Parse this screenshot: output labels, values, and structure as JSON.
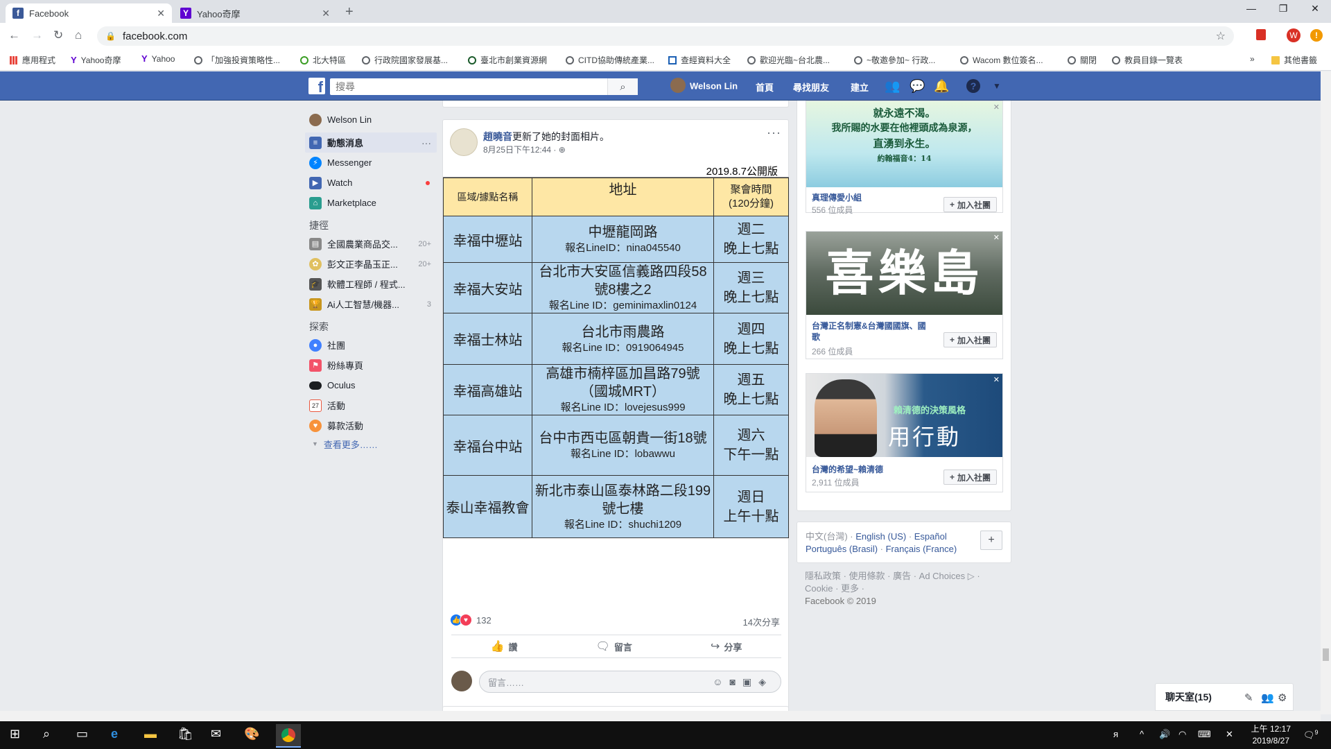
{
  "browser": {
    "tabs": [
      {
        "title": "Facebook",
        "icon": "facebook-icon",
        "active": true
      },
      {
        "title": "Yahoo奇摩",
        "icon": "yahoo-icon",
        "active": false
      }
    ],
    "url": "facebook.com",
    "bookmarks": [
      "應用程式",
      "Yahoo奇摩",
      "Yahoo",
      "「加強投資策略性...",
      "北大特區",
      "行政院國家發展基...",
      "臺北市創業資源網",
      "CITD協助傳統產業...",
      "查經資料大全",
      "歡迎光臨~台北農...",
      "~敬邀參加~ 行政...",
      "Wacom 數位簽名...",
      "關閉",
      "教員目錄一覽表",
      "»",
      "其他書籤"
    ]
  },
  "fb": {
    "search_placeholder": "搜尋",
    "user_name": "Welson Lin",
    "nav_home": "首頁",
    "nav_find_friends": "尋找朋友",
    "nav_create": "建立"
  },
  "leftnav": {
    "profile": "Welson Lin",
    "main": [
      {
        "label": "動態消息",
        "icon": "newsfeed-icon",
        "color": "#4267b2"
      },
      {
        "label": "Messenger",
        "icon": "messenger-icon",
        "color": "#0084ff"
      },
      {
        "label": "Watch",
        "icon": "watch-icon",
        "color": "#4267b2"
      },
      {
        "label": "Marketplace",
        "icon": "marketplace-icon",
        "color": "#2a9d8f"
      }
    ],
    "shortcuts_title": "捷徑",
    "shortcuts": [
      {
        "label": "全國農業商品交...",
        "count": "20+"
      },
      {
        "label": "彭文正李晶玉正...",
        "count": "20+"
      },
      {
        "label": "軟體工程師 / 程式...",
        "count": ""
      },
      {
        "label": "Ai人工智慧/機器...",
        "count": "3"
      }
    ],
    "explore_title": "探索",
    "explore": [
      {
        "label": "社團",
        "icon": "groups-icon",
        "color": "#4080ff"
      },
      {
        "label": "粉絲專頁",
        "icon": "pages-icon",
        "color": "#f35369"
      },
      {
        "label": "Oculus",
        "icon": "oculus-icon",
        "color": "#1c1e21"
      },
      {
        "label": "活動",
        "icon": "events-icon",
        "color": "#e9573f"
      },
      {
        "label": "募款活動",
        "icon": "fundraisers-icon",
        "color": "#f7923b"
      }
    ],
    "see_more": "查看更多……"
  },
  "post": {
    "author": "趙曉音",
    "action": "更新了她的封面相片。",
    "time": "8月25日下午12:44 · ",
    "more": "···",
    "schedule": {
      "version": "2019.8.7公開版",
      "headers": [
        "區域/據點名稱",
        "地址",
        "聚會時間",
        "(120分鐘)"
      ],
      "rows": [
        {
          "name": "幸福中壢站",
          "addr": "中壢龍岡路",
          "line": "報名LineID：nina045540",
          "day": "週二",
          "time": "晚上七點"
        },
        {
          "name": "幸福大安站",
          "addr": "台北市大安區信義路四段58號8樓之2",
          "line": "報名Line ID：geminimaxlin0124",
          "day": "週三",
          "time": "晚上七點"
        },
        {
          "name": "幸福士林站",
          "addr": "台北市雨農路",
          "line": "報名Line ID：0919064945",
          "day": "週四",
          "time": "晚上七點"
        },
        {
          "name": "幸福高雄站",
          "addr": "高雄市楠梓區加昌路79號（國城MRT）",
          "line": "報名Line ID：lovejesus999",
          "day": "週五",
          "time": "晚上七點"
        },
        {
          "name": "幸福台中站",
          "addr": "台中市西屯區朝貴一街18號",
          "line": "報名Line ID：lobawwu",
          "day": "週六",
          "time": "下午一點"
        },
        {
          "name": "泰山幸福教會",
          "addr": "新北市泰山區泰林路二段199號七樓",
          "line": "報名Line ID：shuchi1209",
          "day": "週日",
          "time": "上午十點"
        }
      ]
    },
    "reaction_count": "132",
    "shares": "14次分享",
    "like": "讚",
    "comment": "留言",
    "share": "分享",
    "comment_placeholder": "留言……"
  },
  "groups": [
    {
      "name": "真理傳愛小組",
      "members": "556 位成員",
      "join": "加入社團",
      "img_text1": "就永遠不渴。",
      "img_text2": "我所賜的水要在他裡頭成為泉源，",
      "img_text3": "直湧到永生。",
      "img_text4": "約翰福音4：14"
    },
    {
      "name": "台灣正名制憲&台灣國國旗、國歌",
      "members": "266 位成員",
      "join": "加入社團",
      "img_text1": "喜樂島"
    },
    {
      "name": "台灣的希望~賴清德",
      "members": "2,911 位成員",
      "join": "加入社團",
      "img_text1": "賴清德的決策風格",
      "img_text2": "用行動"
    }
  ],
  "footer": {
    "lang_current": "中文(台灣)",
    "langs": [
      "English (US)",
      "Español",
      "Português (Brasil)",
      "Français (France)"
    ],
    "links_line1": "隱私政策 · 使用條款 · 廣告 · Ad Choices ▷ ·",
    "links_line2": "Cookie · 更多 ·",
    "copyright": "Facebook © 2019"
  },
  "chat": {
    "label": "聊天室(15)"
  },
  "taskbar": {
    "time": "上午 12:17",
    "date": "2019/8/27",
    "notif": "9"
  },
  "colors": {
    "fb_blue": "#4267b2",
    "table_head": "#fee7a5",
    "table_row": "#b8d7ee"
  }
}
